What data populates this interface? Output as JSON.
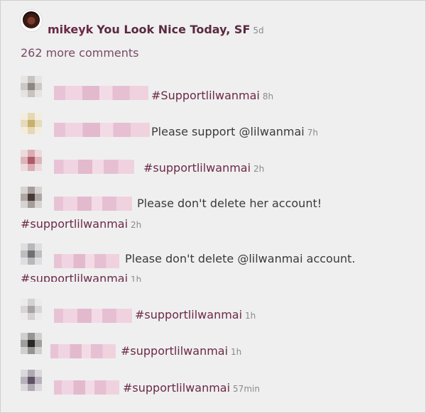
{
  "post": {
    "username": "mikeyk",
    "caption": "You Look Nice Today, SF",
    "age": "5d",
    "more_comments": "262 more comments"
  },
  "comments": [
    {
      "text": "#Supportlilwanmai",
      "text2": "",
      "time": "8h",
      "avatar_color": "#8e8680"
    },
    {
      "text": "Please support @lilwanmai",
      "text2": "",
      "time": "7h",
      "avatar_color": "#c8b06a"
    },
    {
      "text": "#supportlilwanmai",
      "text2": "",
      "time": "2h",
      "avatar_color": "#b25a68"
    },
    {
      "text": "Please don't delete her account!",
      "text2": "#supportlilwanmai",
      "time": "2h",
      "avatar_color": "#4a3a36"
    },
    {
      "text": "Please don't delete @lilwanmai account.",
      "text2": "#supportlilwanmai",
      "time": "1h",
      "avatar_color": "#6f6f74"
    },
    {
      "text": "#supportlilwanmai",
      "text2": "",
      "time": "1h",
      "avatar_color": "#a8a2a4"
    },
    {
      "text": "#supportlilwanmai",
      "text2": "",
      "time": "1h",
      "avatar_color": "#2c2626"
    },
    {
      "text": "#supportlilwanmai",
      "text2": "",
      "time": "57min",
      "avatar_color": "#5e5266"
    }
  ]
}
